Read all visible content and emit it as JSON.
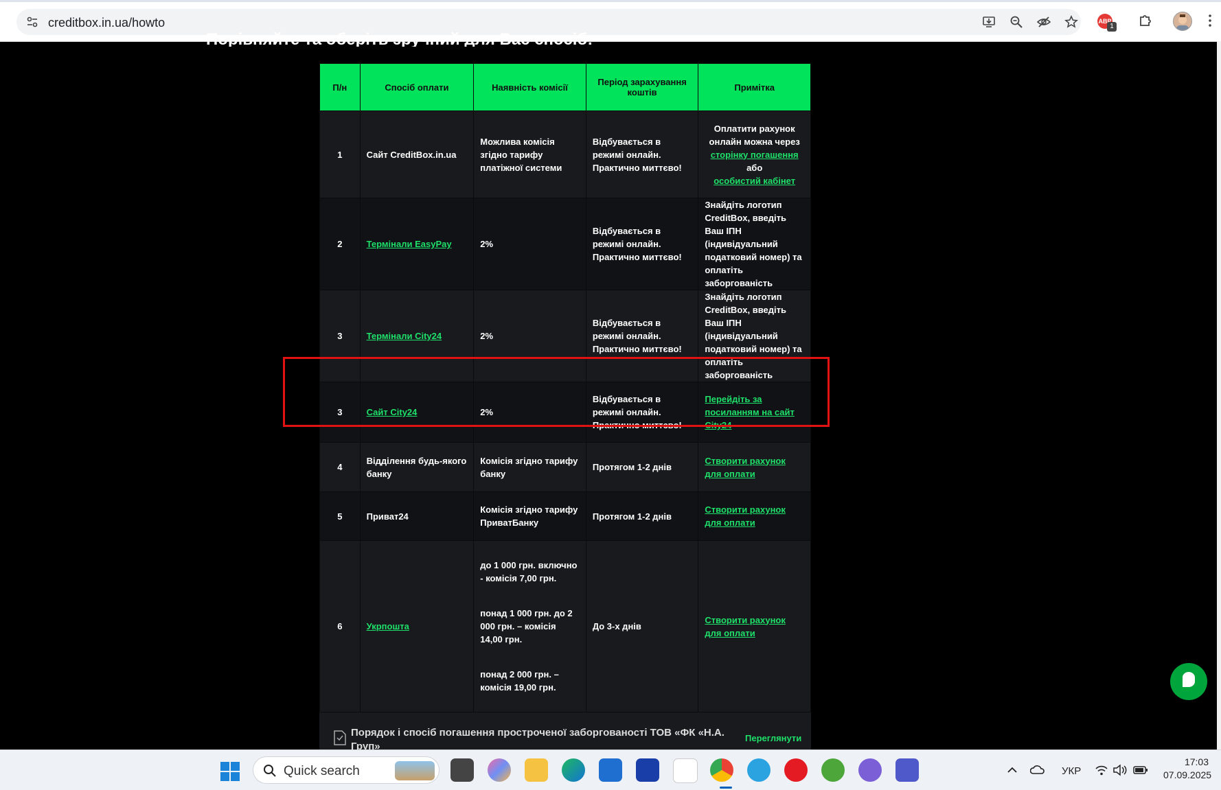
{
  "browser": {
    "url": "creditbox.in.ua/howto",
    "extension_badge": "ABP",
    "extension_count": "1"
  },
  "page": {
    "heading": "Порівняйте та оберіть зручний для Вас спосіб:",
    "table": {
      "headers": [
        "П/н",
        "Спосіб оплати",
        "Наявність комісії",
        "Період зарахування коштів",
        "Примітка"
      ],
      "rows": [
        {
          "num": "1",
          "method": "Сайт CreditBox.in.ua",
          "fee": "Можлива комісія згідно тарифу платіжної системи",
          "period": "Відбувається в режимі онлайн. Практично миттєво!",
          "note_pre": "Оплатити рахунок онлайн можна через",
          "note_link1": "сторінку погашення",
          "note_mid": "або",
          "note_link2": "особистий кабінет"
        },
        {
          "num": "2",
          "method": "Термінали EasyPay",
          "fee": "2%",
          "period": "Відбувається в режимі онлайн. Практично миттєво!",
          "note": "Знайдіть логотип CreditBox, введіть Ваш ІПН (індивідуальний податковий номер) та оплатіть заборгованість"
        },
        {
          "num": "3",
          "method": "Термінали City24",
          "fee": "2%",
          "period": "Відбувається в режимі онлайн. Практично миттєво!",
          "note": "Знайдіть логотип CreditBox, введіть Ваш ІПН (індивідуальний податковий номер) та оплатіть заборгованість"
        },
        {
          "num": "3",
          "method": "Сайт City24",
          "fee": "2%",
          "period": "Відбувається в режимі онлайн. Практично миттєво!",
          "note": "Перейдіть за посиланням на сайт City24"
        },
        {
          "num": "4",
          "method": "Відділення будь-якого банку",
          "fee": "Комісія згідно тарифу банку",
          "period": "Протягом 1-2 днів",
          "note": "Створити рахунок для оплати"
        },
        {
          "num": "5",
          "method": "Приват24",
          "fee": "Комісія згідно тарифу ПриватБанку",
          "period": "Протягом 1-2 днів",
          "note": "Створити рахунок для оплати"
        },
        {
          "num": "6",
          "method": "Укрпошта",
          "fee1": "до 1 000 грн. включно - комісія 7,00 грн.",
          "fee2": "понад 1 000 грн. до 2 000 грн. – комісія 14,00 грн.",
          "fee3": "понад 2 000 грн. – комісія 19,00 грн.",
          "period": "До 3-х днів",
          "note": "Створити рахунок для оплати"
        }
      ]
    },
    "banner": {
      "text": "Порядок і спосіб погашення простроченої заборгованості ТОВ «ФК «Н.А. Груп»",
      "link": "Переглянути"
    }
  },
  "taskbar": {
    "search_placeholder": "Quick search",
    "language": "УКР",
    "time": "17:03",
    "date": "07.09.2025"
  },
  "colors": {
    "accent_green": "#00e35a",
    "link_green": "#1ee06a",
    "highlight_red": "#e01212"
  }
}
